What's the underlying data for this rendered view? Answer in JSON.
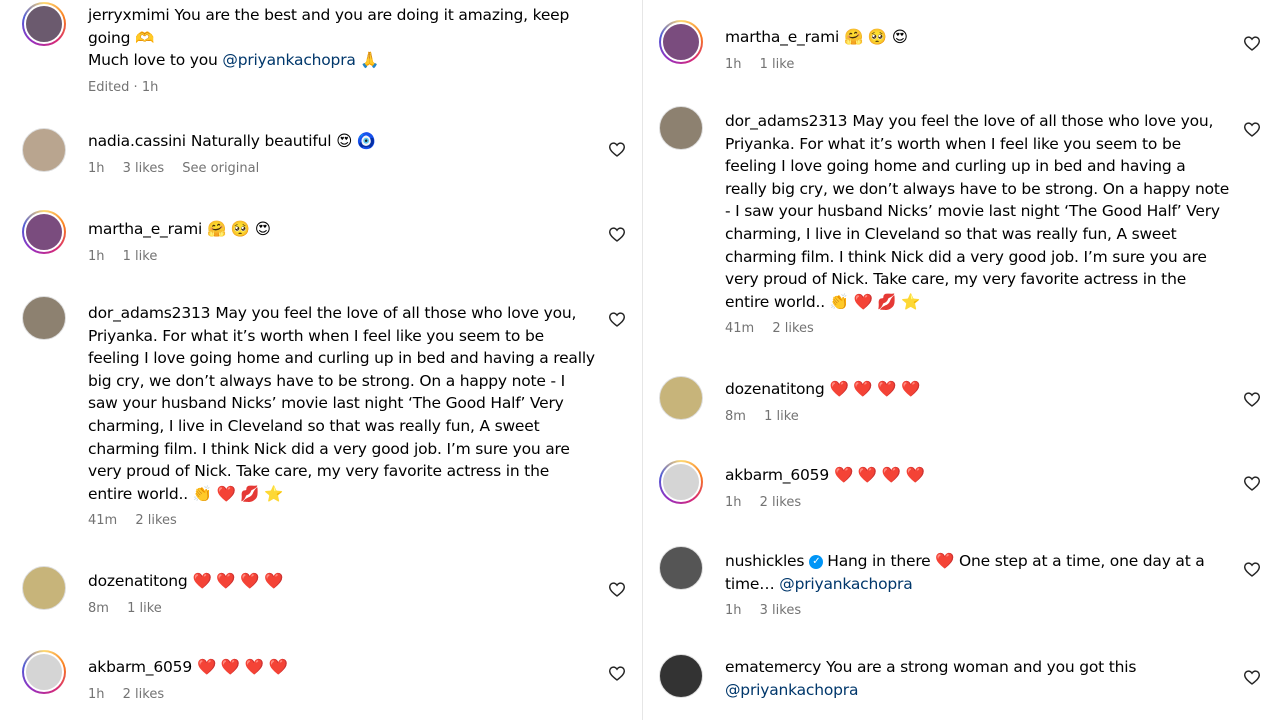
{
  "left": {
    "comments": [
      {
        "username": "jerryxmimi",
        "text": "You are the best and you are doing it amazing, keep going 🫶",
        "text2": "Much love to you",
        "mention": "@priyankachopra",
        "after": "🙏",
        "meta1": "Edited · 1h",
        "meta2": "",
        "meta3": ""
      },
      {
        "username": "nadia.cassini",
        "text": "Naturally beautiful 😍 🧿",
        "meta1": "1h",
        "meta2": "3 likes",
        "meta3": "See original"
      },
      {
        "username": "martha_e_rami",
        "text": "🤗 🥺 😍",
        "meta1": "1h",
        "meta2": "1 like",
        "meta3": ""
      },
      {
        "username": "dor_adams2313",
        "text": "May you feel the love of all those who love you, Priyanka. For what it’s worth when I feel like you seem to be feeling I love going home and curling up in bed and having a really big cry, we don’t always have to be strong. On a happy note - I saw your husband Nicks’ movie last night ‘The Good Half’ Very charming, I live in Cleveland so that was really fun, A sweet charming film. I think Nick did a very good job. I’m sure you are very proud of Nick. Take care, my very favorite actress in the entire world.. 👏 ❤️ 💋 ⭐",
        "meta1": "41m",
        "meta2": "2 likes",
        "meta3": ""
      },
      {
        "username": "dozenatitong",
        "text": "❤️ ❤️ ❤️ ❤️",
        "meta1": "8m",
        "meta2": "1 like",
        "meta3": ""
      },
      {
        "username": "akbarm_6059",
        "text": "❤️ ❤️ ❤️ ❤️",
        "meta1": "1h",
        "meta2": "2 likes",
        "meta3": ""
      }
    ]
  },
  "right": {
    "comments": [
      {
        "username": "martha_e_rami",
        "text": "🤗 🥺 😍",
        "meta1": "1h",
        "meta2": "1 like"
      },
      {
        "username": "dor_adams2313",
        "text": "May you feel the love of all those who love you, Priyanka. For what it’s worth when I feel like you seem to be feeling I love going home and curling up in bed and having a really big cry, we don’t always have to be strong. On a happy note - I saw your husband Nicks’ movie last night ‘The Good Half’ Very charming, I live in Cleveland so that was really fun, A sweet charming film. I think Nick did a very good job. I’m sure you are very proud of Nick. Take care, my very favorite actress in the entire world.. 👏 ❤️ 💋 ⭐",
        "meta1": "41m",
        "meta2": "2 likes"
      },
      {
        "username": "dozenatitong",
        "text": "❤️ ❤️ ❤️ ❤️",
        "meta1": "8m",
        "meta2": "1 like"
      },
      {
        "username": "akbarm_6059",
        "text": "❤️ ❤️ ❤️ ❤️",
        "meta1": "1h",
        "meta2": "2 likes"
      },
      {
        "username": "nushickles",
        "text": "Hang in there ❤️  One step at a time, one day at a time…",
        "mention": "@priyankachopra",
        "meta1": "1h",
        "meta2": "3 likes"
      },
      {
        "username": "ematemercy",
        "text": "You are a strong woman and you got this",
        "mention": "@priyankachopra"
      }
    ]
  },
  "icons": {
    "like": "heart-icon",
    "verified": "verified-badge-icon"
  },
  "colors": {
    "mention": "#00376b",
    "meta": "#737373",
    "verified": "#0095f6"
  }
}
